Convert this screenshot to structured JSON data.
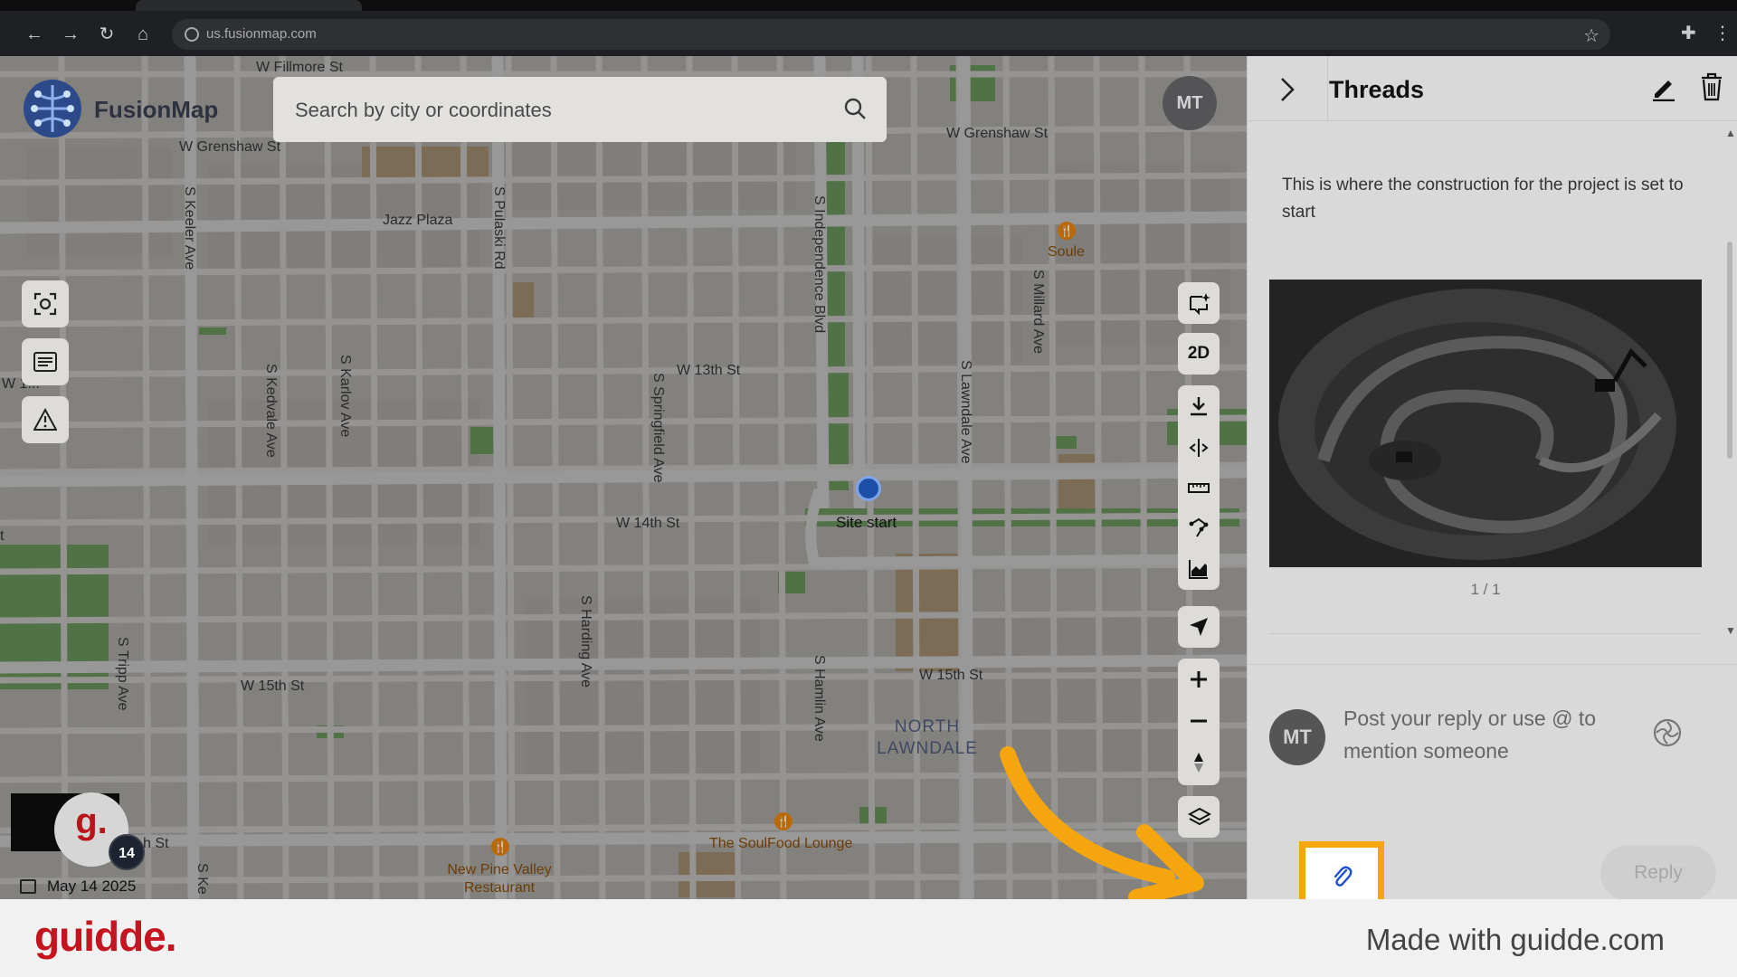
{
  "browser": {
    "url": "us.fusionmap.com"
  },
  "app": {
    "name": "FusionMap",
    "search_placeholder": "Search by city or coordinates",
    "user_initials": "MT"
  },
  "map": {
    "streets_h": [
      {
        "name": "W Fillmore St"
      },
      {
        "name": "W Grenshaw St"
      },
      {
        "name": "W Grenshaw St"
      },
      {
        "name": "W 13th St"
      },
      {
        "name": "W 14th St"
      },
      {
        "name": "W 15th St"
      },
      {
        "name": "W 15th St"
      },
      {
        "name": "h St"
      },
      {
        "name": "W 1..."
      },
      {
        "name": "t"
      }
    ],
    "streets_v": [
      {
        "name": "S Keeler Ave"
      },
      {
        "name": "S Pulaski Rd"
      },
      {
        "name": "S Kedvale Ave"
      },
      {
        "name": "S Karlov Ave"
      },
      {
        "name": "S Springfield Ave"
      },
      {
        "name": "S Independence Blvd"
      },
      {
        "name": "S Harding Ave"
      },
      {
        "name": "S Hamlin Ave"
      },
      {
        "name": "S Lawndale Ave"
      },
      {
        "name": "S Millard Ave"
      },
      {
        "name": "S Tripp Ave"
      },
      {
        "name": "S Ke"
      }
    ],
    "pois": [
      {
        "name": "Jazz Plaza"
      },
      {
        "name": "Soule"
      },
      {
        "name": "The SoulFood Lounge"
      },
      {
        "name": "New Pine Valley Restaurant"
      }
    ],
    "neighborhood": "NORTH LAWNDALE",
    "marker_label": "Site start",
    "toolbar_2d": "2D",
    "date": "May 14 2025",
    "badge_letter": "g.",
    "badge_count": "14"
  },
  "threads": {
    "title": "Threads",
    "message": "This is where the construction for the project is set to start",
    "image_counter": "1 / 1",
    "reply_avatar": "MT",
    "reply_placeholder": "Post your reply or use @ to mention someone",
    "reply_button": "Reply"
  },
  "footer": {
    "brand": "guidde.",
    "made_with": "Made with guidde.com"
  },
  "colors": {
    "highlight": "#f5a60f",
    "brand_red": "#c3141f",
    "marker_blue": "#1e4fa8"
  }
}
